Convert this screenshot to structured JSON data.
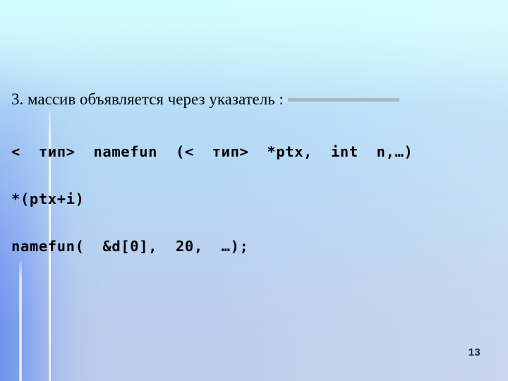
{
  "slide": {
    "heading": "3. массив объявляется через указатель :",
    "code_lines": [
      "<  тип>  namefun  (<  тип>  *ptx,  int  n,…)",
      "*(ptx+i)",
      "namefun(  &d[0],  20,  …);"
    ],
    "page_number": "13",
    "colors": {
      "background_top": "#cefbfc",
      "background_bottom_left": "#6e91f0",
      "background_bottom_right": "#becdec",
      "heading_bar": "#a9b9c1",
      "text": "#000000",
      "page_number_text": "#1d2b4d",
      "rule_line": "#ffffff"
    }
  }
}
